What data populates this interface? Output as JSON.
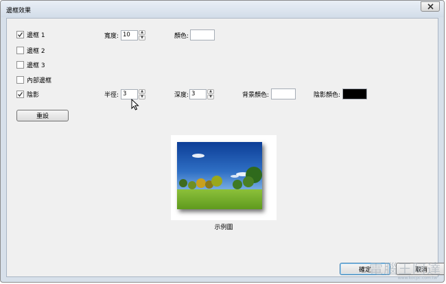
{
  "window": {
    "title": "邊框效果"
  },
  "close_icon": "close-icon",
  "options": {
    "border1": {
      "label": "邊框 1",
      "checked": true
    },
    "border2": {
      "label": "邊框 2",
      "checked": false
    },
    "border3": {
      "label": "邊框 3",
      "checked": false
    },
    "inner_border": {
      "label": "內部邊框",
      "checked": false
    },
    "shadow": {
      "label": "陰影",
      "checked": true
    }
  },
  "border1_settings": {
    "width_label": "寬度:",
    "width_value": "10",
    "color_label": "顏色:",
    "color_value": "#ffffff"
  },
  "shadow_settings": {
    "radius_label": "半徑:",
    "radius_value": "3",
    "depth_label": "深度:",
    "depth_value": "3",
    "bg_color_label": "背景顏色:",
    "bg_color_value": "#ffffff",
    "shadow_color_label": "陰影顏色:",
    "shadow_color_value": "#000000"
  },
  "reset_button": "重設",
  "preview": {
    "caption": "示例圖"
  },
  "ok_button": "確定",
  "cancel_button": "取消",
  "watermark": {
    "text": "電腦王阿達",
    "sub": "www.kocpc.com.tw"
  }
}
